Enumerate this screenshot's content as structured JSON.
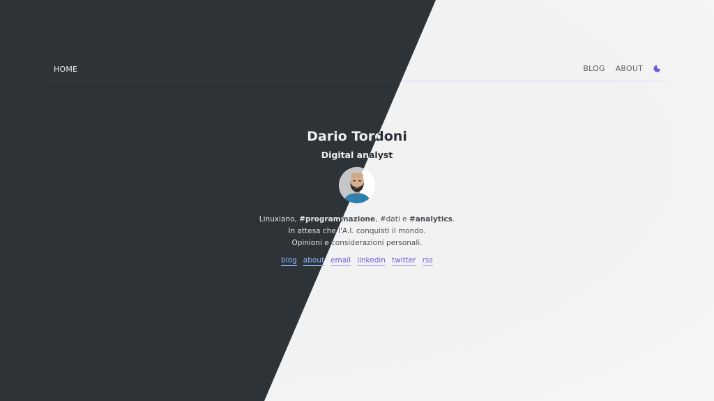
{
  "nav": {
    "home_label": "HOME",
    "blog_label": "BLOG",
    "about_label": "ABOUT",
    "theme_toggle_icon": "moon-icon"
  },
  "profile": {
    "name": "Dario Tordoni",
    "role": "Digital analyst",
    "avatar_icon": "bearded-man-avatar",
    "bio_line1_start": "Linuxiano, ",
    "bio_line1_tag1": "#programmazione",
    "bio_line1_mid": ", #dati e ",
    "bio_line1_tag2": "#analytics",
    "bio_line1_end": ".",
    "bio_line2": "In attesa che l'A.I. conquisti il mondo.",
    "bio_line3": "Opinioni e considerazioni personali."
  },
  "links": [
    {
      "label": "blog"
    },
    {
      "label": "about"
    },
    {
      "label": "email"
    },
    {
      "label": "linkedin"
    },
    {
      "label": "twitter"
    },
    {
      "label": "rss"
    }
  ],
  "colors": {
    "light_bg": "#f2f2f2",
    "dark_bg": "#2e3338",
    "accent": "#6b5fd6",
    "dark_link": "#8fb8ff"
  }
}
